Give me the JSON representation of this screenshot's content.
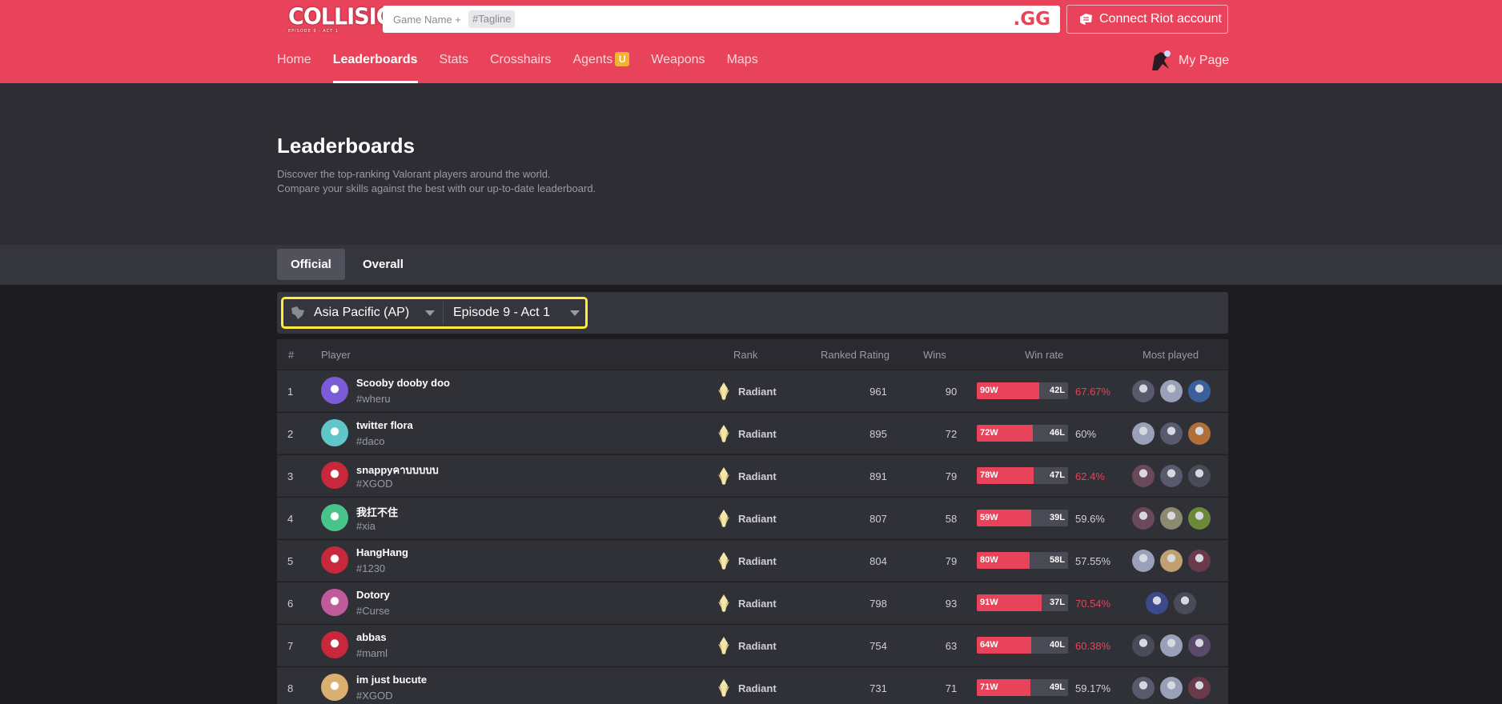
{
  "header": {
    "logo": {
      "title": "COLLISION",
      "subtitle": "EPISODE 9 · ACT 1"
    },
    "search": {
      "placeholder": "Game Name +",
      "tag": "#Tagline",
      "brand": ".GG"
    },
    "connect_label": "Connect Riot account",
    "nav": [
      {
        "label": "Home",
        "active": false
      },
      {
        "label": "Leaderboards",
        "active": true
      },
      {
        "label": "Stats",
        "active": false
      },
      {
        "label": "Crosshairs",
        "active": false
      },
      {
        "label": "Agents",
        "active": false,
        "badge": "U"
      },
      {
        "label": "Weapons",
        "active": false
      },
      {
        "label": "Maps",
        "active": false
      }
    ],
    "my_page": "My Page"
  },
  "hero": {
    "title": "Leaderboards",
    "desc1": "Discover the top-ranking Valorant players around the world.",
    "desc2": "Compare your skills against the best with our up-to-date leaderboard."
  },
  "tabs": {
    "official": "Official",
    "overall": "Overall"
  },
  "filters": {
    "region": "Asia Pacific (AP)",
    "episode": "Episode 9 - Act 1"
  },
  "table": {
    "headers": {
      "num": "#",
      "player": "Player",
      "rank": "Rank",
      "rating": "Ranked Rating",
      "wins": "Wins",
      "winrate": "Win rate",
      "most_played": "Most played"
    },
    "rows": [
      {
        "num": "1",
        "name": "Scooby dooby doo",
        "tag": "#wheru",
        "rank": "Radiant",
        "rating": "961",
        "wins": "90",
        "w": "90W",
        "l": "42L",
        "win_fraction": 0.68,
        "rate": "67.67%",
        "hot": true,
        "avatar_color": "#7b5bd6",
        "agents": [
          "#5a5a6e",
          "#9aa0b8",
          "#3a5f9a"
        ]
      },
      {
        "num": "2",
        "name": "twitter flora",
        "tag": "#daco",
        "rank": "Radiant",
        "rating": "895",
        "wins": "72",
        "w": "72W",
        "l": "46L",
        "win_fraction": 0.61,
        "rate": "60%",
        "hot": false,
        "avatar_color": "#5fc7c9",
        "agents": [
          "#9aa0b8",
          "#5a5a6e",
          "#b0703a"
        ]
      },
      {
        "num": "3",
        "name": "snappyคาบบบบบ",
        "tag": "#XGOD",
        "rank": "Radiant",
        "rating": "891",
        "wins": "79",
        "w": "78W",
        "l": "47L",
        "win_fraction": 0.62,
        "rate": "62.4%",
        "hot": true,
        "avatar_color": "#c8283c",
        "agents": [
          "#6a4a5a",
          "#5a5a6e",
          "#4a4a58"
        ]
      },
      {
        "num": "4",
        "name": "我扛不住",
        "tag": "#xia",
        "rank": "Radiant",
        "rating": "807",
        "wins": "58",
        "w": "59W",
        "l": "39L",
        "win_fraction": 0.6,
        "rate": "59.6%",
        "hot": false,
        "avatar_color": "#48c48a",
        "agents": [
          "#6a4a5a",
          "#8a8a70",
          "#6a8a3a"
        ]
      },
      {
        "num": "5",
        "name": "HangHang",
        "tag": "#1230",
        "rank": "Radiant",
        "rating": "804",
        "wins": "79",
        "w": "80W",
        "l": "58L",
        "win_fraction": 0.58,
        "rate": "57.55%",
        "hot": false,
        "avatar_color": "#c8283c",
        "agents": [
          "#9aa0b8",
          "#c0a070",
          "#6a3a4a"
        ]
      },
      {
        "num": "6",
        "name": "Dotory",
        "tag": "#Curse",
        "rank": "Radiant",
        "rating": "798",
        "wins": "93",
        "w": "91W",
        "l": "37L",
        "win_fraction": 0.71,
        "rate": "70.54%",
        "hot": true,
        "avatar_color": "#c05a9a",
        "agents": [
          "#3a4a8a",
          "#4a4a58"
        ]
      },
      {
        "num": "7",
        "name": "abbas",
        "tag": "#maml",
        "rank": "Radiant",
        "rating": "754",
        "wins": "63",
        "w": "64W",
        "l": "40L",
        "win_fraction": 0.6,
        "rate": "60.38%",
        "hot": true,
        "avatar_color": "#c8283c",
        "agents": [
          "#4a4a58",
          "#9aa0b8",
          "#5a4a6a"
        ]
      },
      {
        "num": "8",
        "name": "im just bucute",
        "tag": "#XGOD",
        "rank": "Radiant",
        "rating": "731",
        "wins": "71",
        "w": "71W",
        "l": "49L",
        "win_fraction": 0.59,
        "rate": "59.17%",
        "hot": false,
        "avatar_color": "#d9b070",
        "agents": [
          "#5a5a6e",
          "#9aa0b8",
          "#6a3a4a"
        ]
      }
    ]
  },
  "colors": {
    "brand": "#e8435a",
    "highlight": "#ffee37",
    "badge": "#f3b233"
  }
}
